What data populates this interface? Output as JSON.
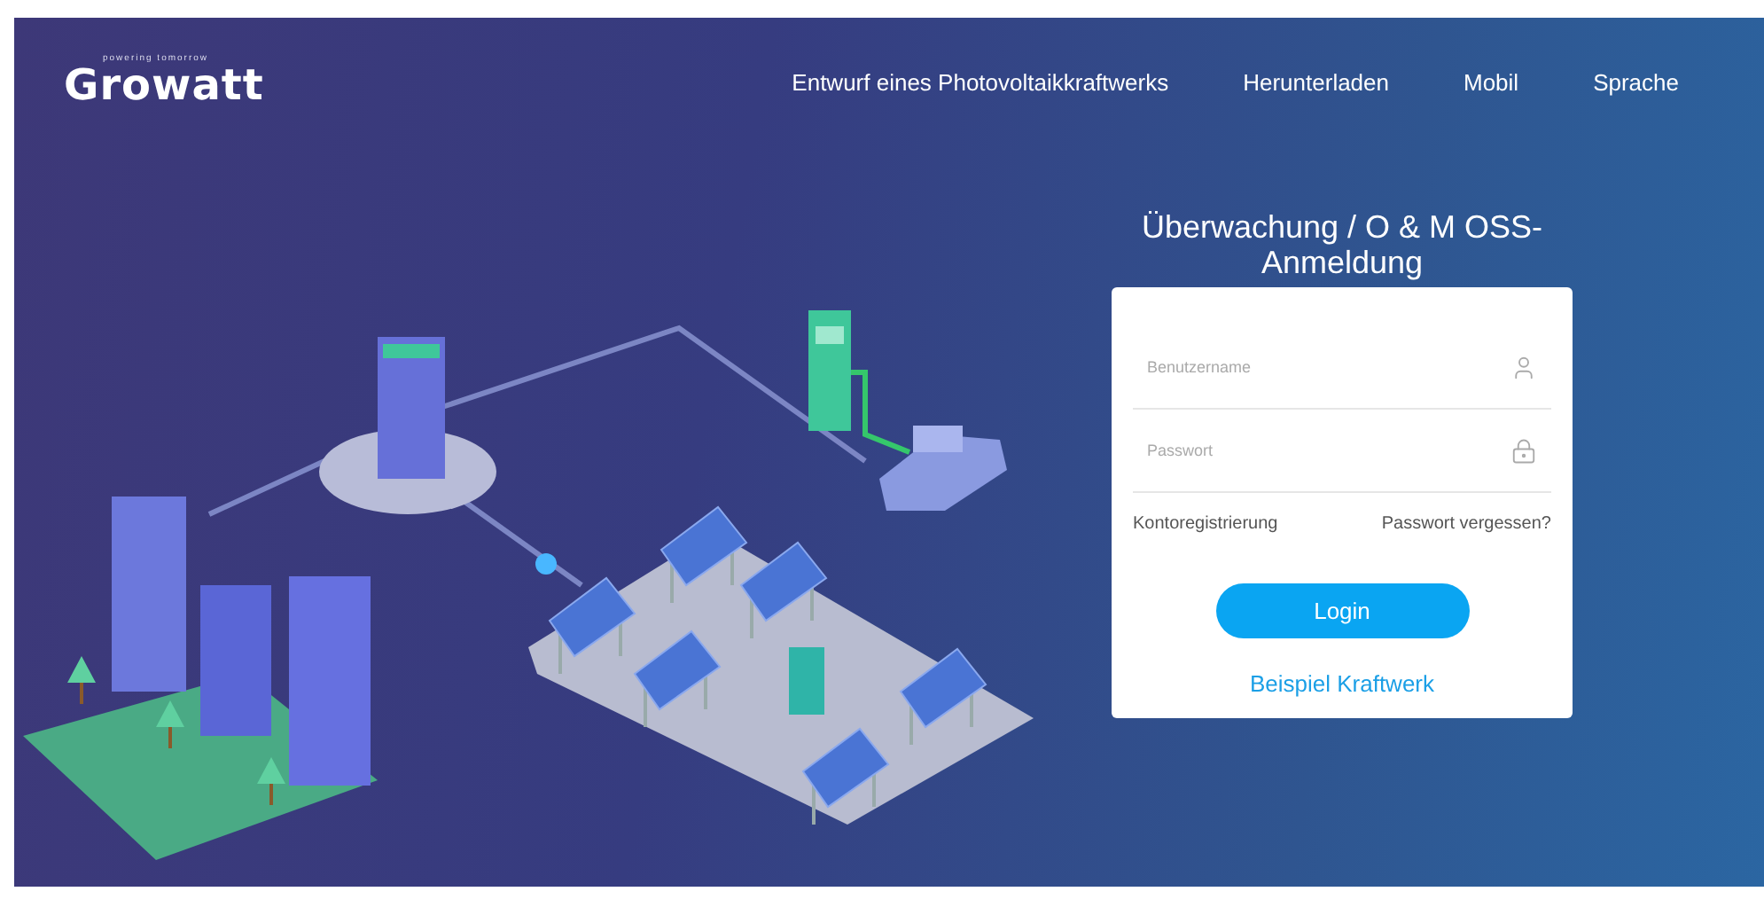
{
  "logo": {
    "name": "Growatt",
    "tagline": "powering tomorrow"
  },
  "nav": [
    "Entwurf eines Photovoltaikkraftwerks",
    "Herunterladen",
    "Mobil",
    "Sprache"
  ],
  "login": {
    "title": "Überwachung / O & M OSS-Anmeldung",
    "username": {
      "placeholder": "Benutzername"
    },
    "password": {
      "placeholder": "Passwort"
    },
    "register_link": "Kontoregistrierung",
    "forgot_link": "Passwort vergessen?",
    "submit": "Login",
    "demo_link": "Beispiel Kraftwerk"
  }
}
